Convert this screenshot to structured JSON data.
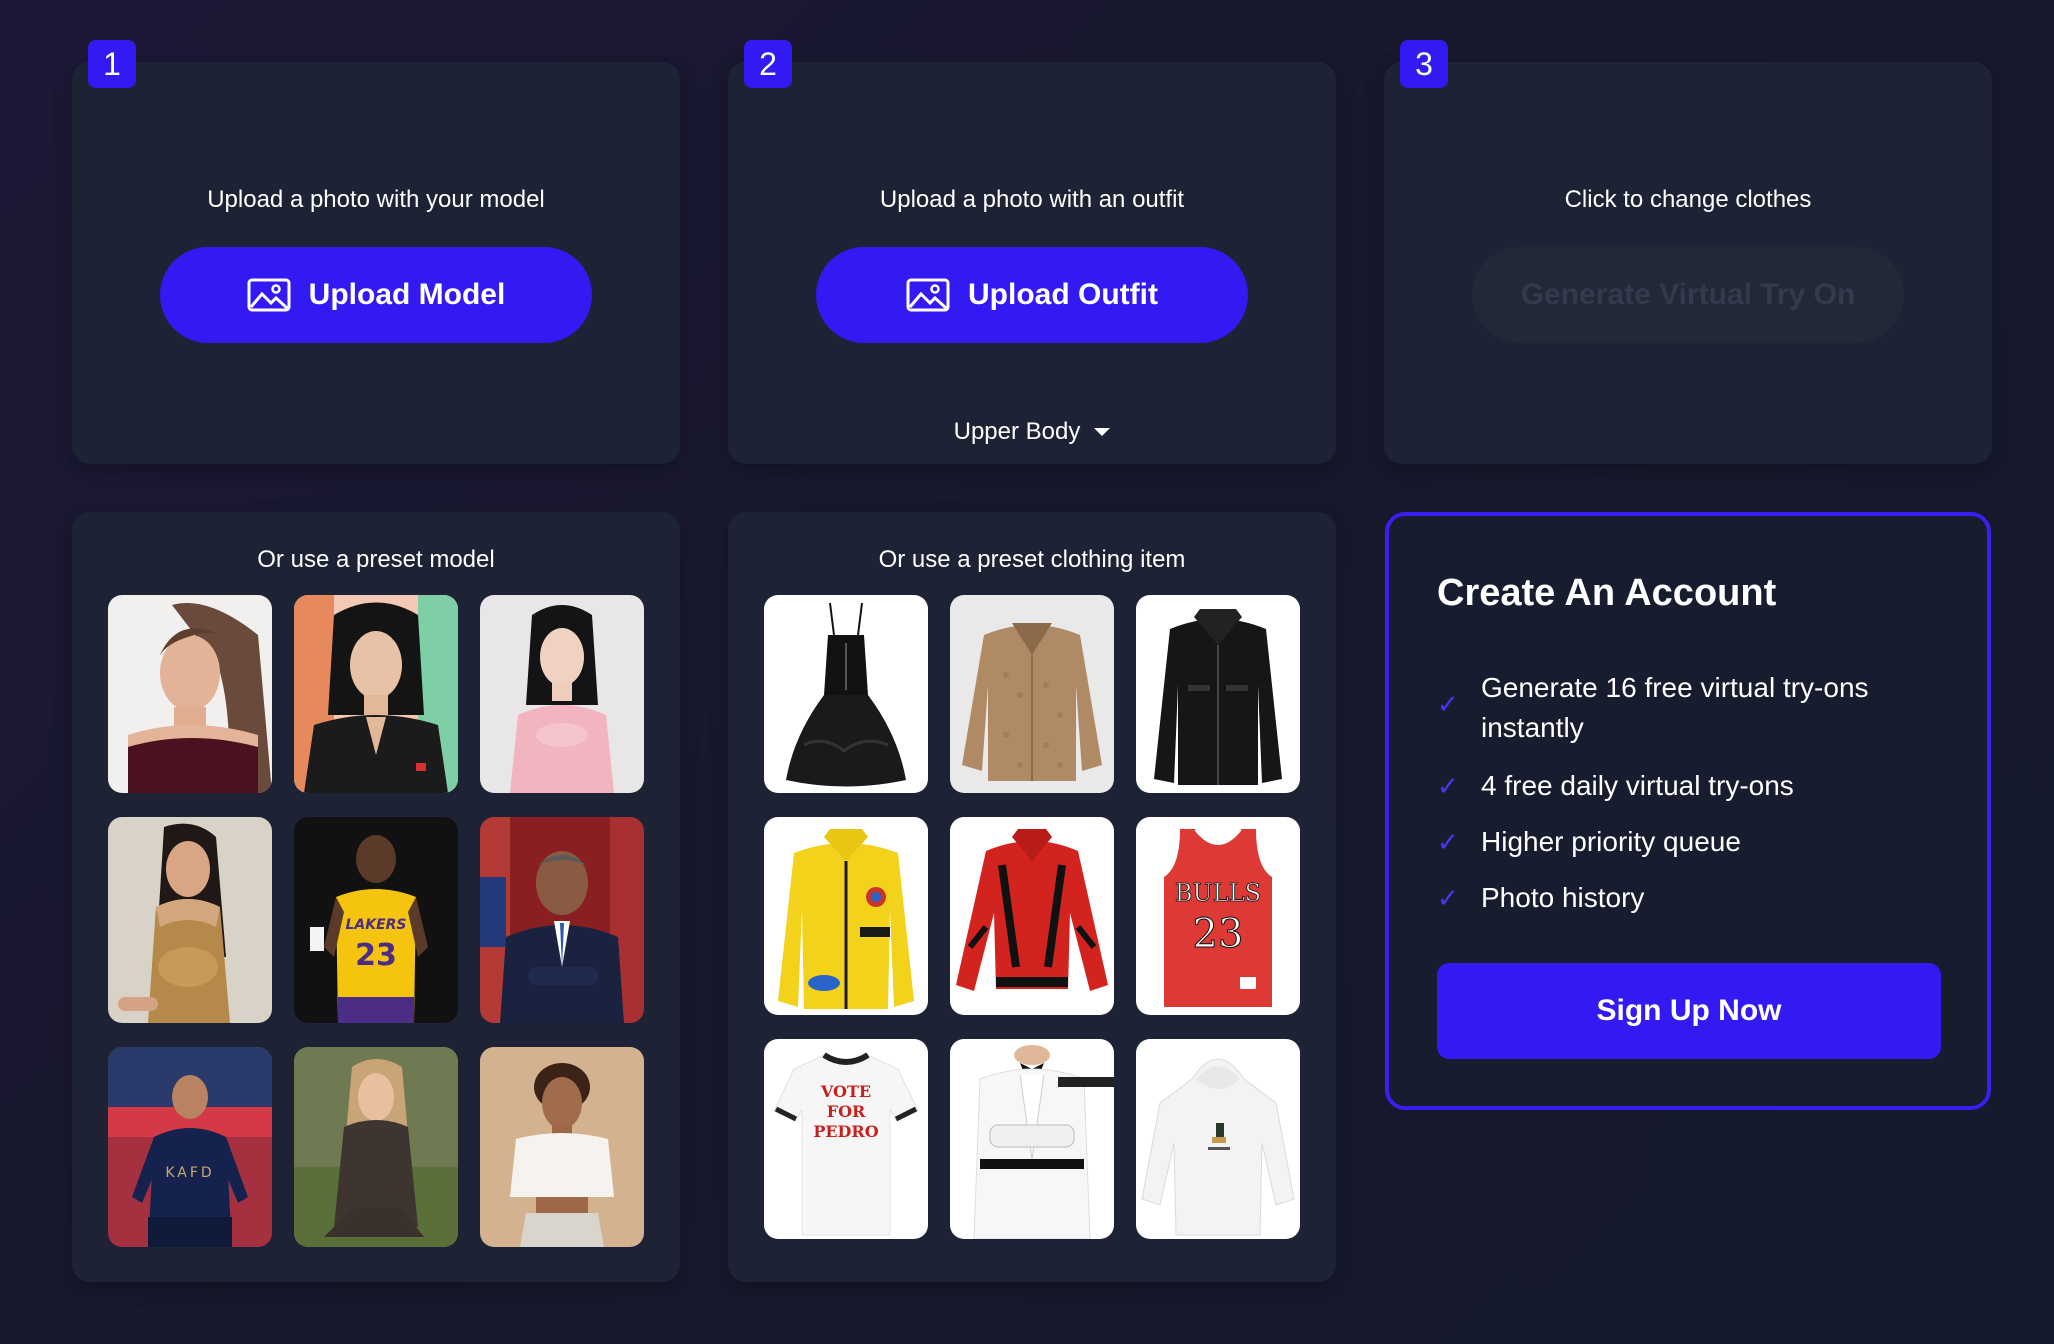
{
  "steps": [
    {
      "number": "1",
      "label": "Upload a photo with your model",
      "button": "Upload Model"
    },
    {
      "number": "2",
      "label": "Upload a photo with an outfit",
      "button": "Upload Outfit",
      "dropdown": "Upper Body"
    },
    {
      "number": "3",
      "label": "Click to change clothes",
      "button": "Generate Virtual Try On"
    }
  ],
  "presets": {
    "models_title": "Or use a preset model",
    "clothing_title": "Or use a preset clothing item"
  },
  "account": {
    "title": "Create An Account",
    "features": [
      "Generate 16 free virtual try-ons instantly",
      "4 free daily virtual try-ons",
      "Higher priority queue",
      "Photo history"
    ],
    "check_icon": "✓",
    "signup_label": "Sign Up Now"
  },
  "clothing_text": {
    "tshirt_lines": [
      "VOTE",
      "FOR",
      "PEDRO"
    ],
    "jersey_text": "BULLS",
    "jersey_number": "23"
  },
  "colors": {
    "accent": "#3319f2",
    "card": "#1d2335",
    "background": "#18182e"
  },
  "icons": {
    "upload": "image-icon",
    "dropdown": "caret-down-icon",
    "check": "check-icon"
  }
}
